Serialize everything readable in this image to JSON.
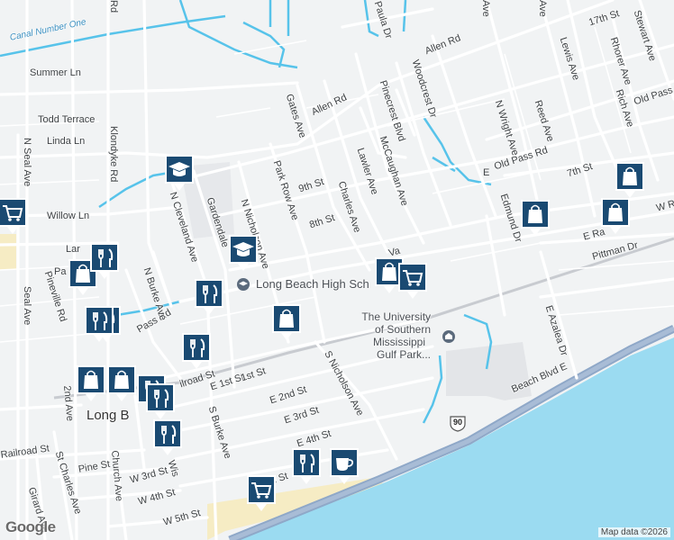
{
  "map": {
    "attribution": "Map data ©2026",
    "logo": "Google",
    "colors": {
      "land": "#f1f3f4",
      "water": "#9bdbf1",
      "road": "#ffffff",
      "highway": "#8fa8c8",
      "canal": "#57c3ea",
      "marker": "#1a4a72",
      "sand": "#f6ecc4"
    }
  },
  "street_labels": {
    "canal": "Canal Number One",
    "summer": "Summer Ln",
    "todd": "Todd Terrace",
    "linda": "Linda Ln",
    "willow": "Willow Ln",
    "klondyke": "Klondyke Rd",
    "n_seal": "N Seal Ave",
    "seal": "Seal Ave",
    "pineville": "Pineville Rd",
    "n_cleveland": "N Cleveland Ave",
    "gardendale": "Gardendale",
    "n_nicholson": "N Nicholson Ave",
    "park_row": "Park Row Ave",
    "gates": "Gates Ave",
    "allen_rd1": "Allen Rd",
    "allen_rd2": "Allen Rd",
    "ninth": "9th St",
    "eighth": "8th St",
    "charles": "Charles Ave",
    "lawler": "Lawler Ave",
    "mccaughan": "McCaughan Ave",
    "pinecrest": "Pinecrest Blvd",
    "woodcrest": "Woodcrest Dr",
    "paula": "Paula Dr",
    "n_wright": "N Wright Ave",
    "reed": "Reed Ave",
    "lewis": "Lewis Ave",
    "seventeenth": "17th St",
    "stewart": "Stewart Ave",
    "rhorer": "Rhorer Ave",
    "rich": "Rich Ave",
    "old_pass_rd1": "Old Pass Rd",
    "old_pass_rd2": "Old Pass Rd",
    "seventh": "7th St",
    "edmund": "Edmund Dr",
    "e_ra": "E Ra",
    "w_r": "W R",
    "pittman": "Pittman Dr",
    "e_azalea": "E Azalea Dr",
    "beach_blvd": "Beach Blvd E",
    "s_nicholson": "S Nicholson Ave",
    "e_first": "E 1st St",
    "first": "1st St",
    "e_second": "E 2nd St",
    "e_third": "E 3rd St",
    "e_fourth": "E 4th St",
    "fifth": "5th St",
    "w_third": "W 3rd St",
    "w_fourth": "W 4th St",
    "w_fifth": "W 5th St",
    "pine": "Pine St",
    "church": "Church Ave",
    "second_ave": "2nd Ave",
    "st_charles": "St Charles Ave",
    "girard": "Girard Ave",
    "railroad": "Railroad St",
    "ilroad": "ilroad St",
    "pass_rd": "Pass Rd",
    "n_burke": "N Burke Ave",
    "s_burke": "S Burke Ave",
    "va": "Va",
    "lar": "Lar",
    "pa": "Pa",
    "ave": "Ave",
    "ave2": "Ave",
    "wis": "Wis",
    "rd": "Rd",
    "e_small": "E"
  },
  "poi_labels": {
    "high_school": "Long Beach High Sch",
    "usm_line1": "The University",
    "usm_line2": "of Southern",
    "usm_line3": "Mississippi",
    "usm_line4": "Gulf Park...",
    "city": "Long B",
    "highway_shield": "90"
  },
  "markers": [
    {
      "kind": "school",
      "icon": "graduation-cap-icon"
    },
    {
      "kind": "school",
      "icon": "graduation-cap-icon"
    },
    {
      "kind": "shop",
      "icon": "shopping-bag-icon"
    },
    {
      "kind": "shop",
      "icon": "shopping-bag-icon"
    },
    {
      "kind": "shop",
      "icon": "shopping-bag-icon"
    },
    {
      "kind": "shop",
      "icon": "shopping-bag-icon"
    },
    {
      "kind": "shop",
      "icon": "shopping-bag-icon"
    },
    {
      "kind": "shop",
      "icon": "shopping-bag-icon"
    },
    {
      "kind": "shop",
      "icon": "shopping-bag-icon"
    },
    {
      "kind": "shop",
      "icon": "shopping-bag-icon"
    },
    {
      "kind": "cart",
      "icon": "shopping-cart-icon"
    },
    {
      "kind": "cart",
      "icon": "shopping-cart-icon"
    },
    {
      "kind": "cart",
      "icon": "shopping-cart-icon"
    },
    {
      "kind": "food",
      "icon": "fork-knife-icon"
    },
    {
      "kind": "food",
      "icon": "fork-knife-icon"
    },
    {
      "kind": "food",
      "icon": "fork-knife-icon"
    },
    {
      "kind": "food",
      "icon": "fork-knife-icon"
    },
    {
      "kind": "food",
      "icon": "fork-knife-icon"
    },
    {
      "kind": "food",
      "icon": "fork-knife-icon"
    },
    {
      "kind": "food",
      "icon": "fork-knife-icon"
    },
    {
      "kind": "food",
      "icon": "fork-knife-icon"
    },
    {
      "kind": "food",
      "icon": "fork-knife-icon"
    },
    {
      "kind": "cafe",
      "icon": "coffee-cup-icon"
    }
  ]
}
